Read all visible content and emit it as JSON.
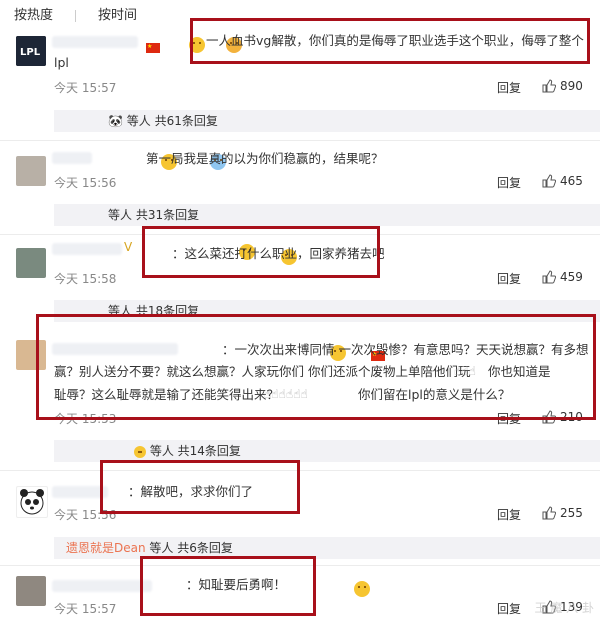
{
  "tabs": {
    "hot": "按热度",
    "time": "按时间"
  },
  "comments": [
    {
      "text": "一人血书vg解散，你们真的是侮辱了职业选手这个职业，侮辱了整个",
      "text2": "lpl",
      "time": "今天 15:57",
      "reply": "回复",
      "likes": "890",
      "sub": "等人 共61条回复"
    },
    {
      "text": "第一局我是真的以为你们稳赢的，结果呢？",
      "time": "今天 15:56",
      "reply": "回复",
      "likes": "465",
      "sub": "等人 共31条回复"
    },
    {
      "text": "：这么菜还打什么职业，回家养猪去吧",
      "time": "今天 15:58",
      "reply": "回复",
      "likes": "459",
      "sub": "等人 共18条回复"
    },
    {
      "line1": "：一次次出来博同情  一次次毁惨？有意思吗？天天说想赢？有多想",
      "line2": "赢？别人送分不要？就这么想赢？人家玩你们 你们还派个废物上单陪他们玩",
      "line2b": "你也知道是",
      "line3": "耻辱？这么耻辱就是输了还能笑得出来？",
      "line3b": "你们留在lpl的意义是什么？",
      "time": "今天 15:53",
      "reply": "回复",
      "likes": "210",
      "sub": "等人 共14条回复"
    },
    {
      "text": "：解散吧，求求你们了",
      "time": "今天 15:56",
      "reply": "回复",
      "likes": "255",
      "sub_prefix": "遗恩就是Dean",
      "sub": "等人 共6条回复"
    },
    {
      "text": "：知耻要后勇啊！",
      "time": "今天 15:57",
      "reply": "回复",
      "likes": "139"
    }
  ],
  "watermark": "王 魔 八 卦",
  "colors": {
    "accent": "#eb7350",
    "box": "#a8101a"
  }
}
